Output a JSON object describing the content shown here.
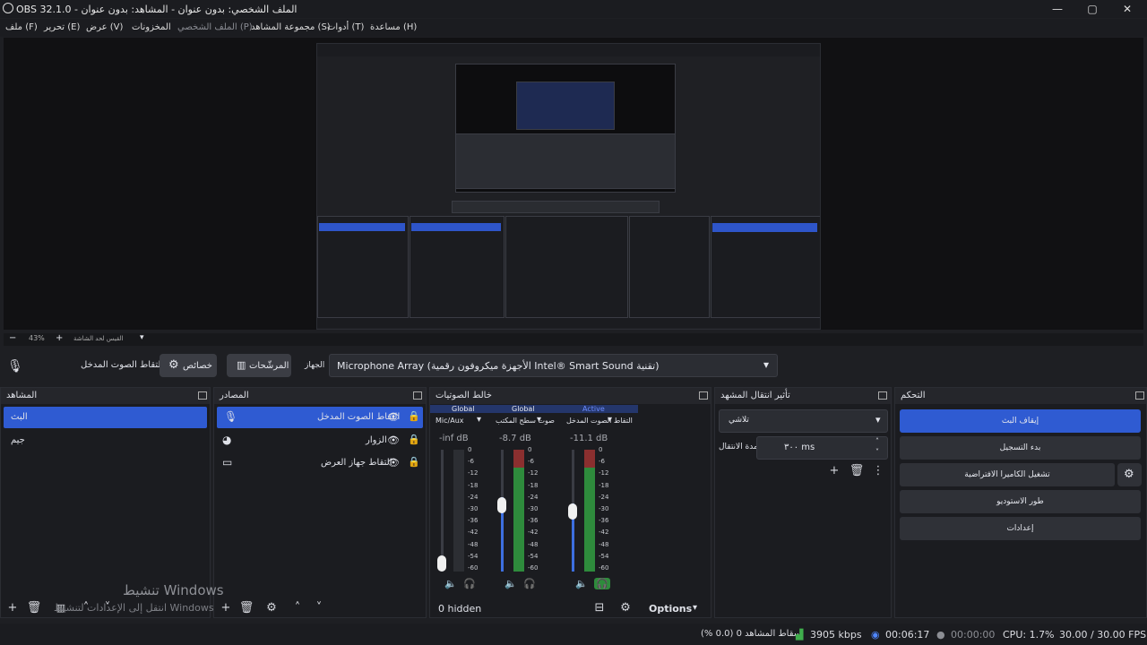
{
  "window": {
    "title": "OBS 32.1.0 - الملف الشخصي: بدون عنوان - المشاهد: بدون عنوان",
    "minimize": "—",
    "maximize": "▢",
    "close": "✕"
  },
  "menu": {
    "file": "ملف (F)",
    "edit": "تحرير (E)",
    "view": "عرض (V)",
    "docks": "المخزونات",
    "profile": "الملف الشخصي (P)",
    "scene_collection": "مجموعة المشاهد (S)",
    "tools": "أدوات (T)",
    "help": "مساعدة (H)"
  },
  "zoom": {
    "value": "43%",
    "scale_label": "القيس لحد الشاشة"
  },
  "context_bar": {
    "source_name": "التقاط الصوت المدخل",
    "properties": "خصائص",
    "filters": "المرشّحات",
    "device_label": "الجهاز",
    "device_value": "Microphone Array (الأجهزة ميكروفون رقمية Intel® Smart Sound تقنية)"
  },
  "scenes": {
    "title": "المشاهد",
    "items": [
      "البث",
      "جيم"
    ]
  },
  "sources": {
    "title": "المصادر",
    "items": [
      "التقاط الصوت المدخل",
      "الزوار",
      "التقاط جهاز العرض"
    ]
  },
  "mixer": {
    "title": "خالط الصوتيات",
    "channels": [
      {
        "tag": "Global",
        "name": "Mic/Aux",
        "db": "-inf dB",
        "level": 0.0
      },
      {
        "tag": "Global",
        "name": "صوت سطح المكتب",
        "db": "-8.7 dB",
        "level": 0.55
      },
      {
        "tag": "Active",
        "name": "التقاط الصوت المدخل",
        "db": "-11.1 dB",
        "level": 0.49
      }
    ],
    "ticks": [
      "0",
      "-6",
      "-12",
      "-18",
      "-24",
      "-30",
      "-36",
      "-42",
      "-48",
      "-54",
      "-60"
    ],
    "hidden": "0 hidden",
    "options": "Options"
  },
  "transitions": {
    "title": "تأثير انتقال المشهد",
    "type": "تلاشي",
    "duration_label": "مدة الانتقال",
    "duration_value": "٣٠٠ ms"
  },
  "controls": {
    "title": "التحكم",
    "stop_stream": "إيقاف البث",
    "start_recording": "بدء التسجيل",
    "virtual_camera": "تشغيل الكاميرا الافتراضية",
    "studio_mode": "طور الاستوديو",
    "settings": "إعدادات"
  },
  "status": {
    "dropped": "إسقاط المشاهد 0 (0.0 %)",
    "bitrate": "3905 kbps",
    "live_time": "00:06:17",
    "rec_time": "00:00:00",
    "cpu": "CPU: 1.7%",
    "fps": "30.00 / 30.00 FPS"
  },
  "watermark": {
    "line1": "تنشيط Windows",
    "line2": "انتقل إلى الإعدادات لتنشيط Windows"
  },
  "colors": {
    "accent": "#2f5bd2",
    "meter_green": "#2e8b3c",
    "meter_red": "#8b2f2f",
    "fader_blue": "#3d6fe0"
  }
}
